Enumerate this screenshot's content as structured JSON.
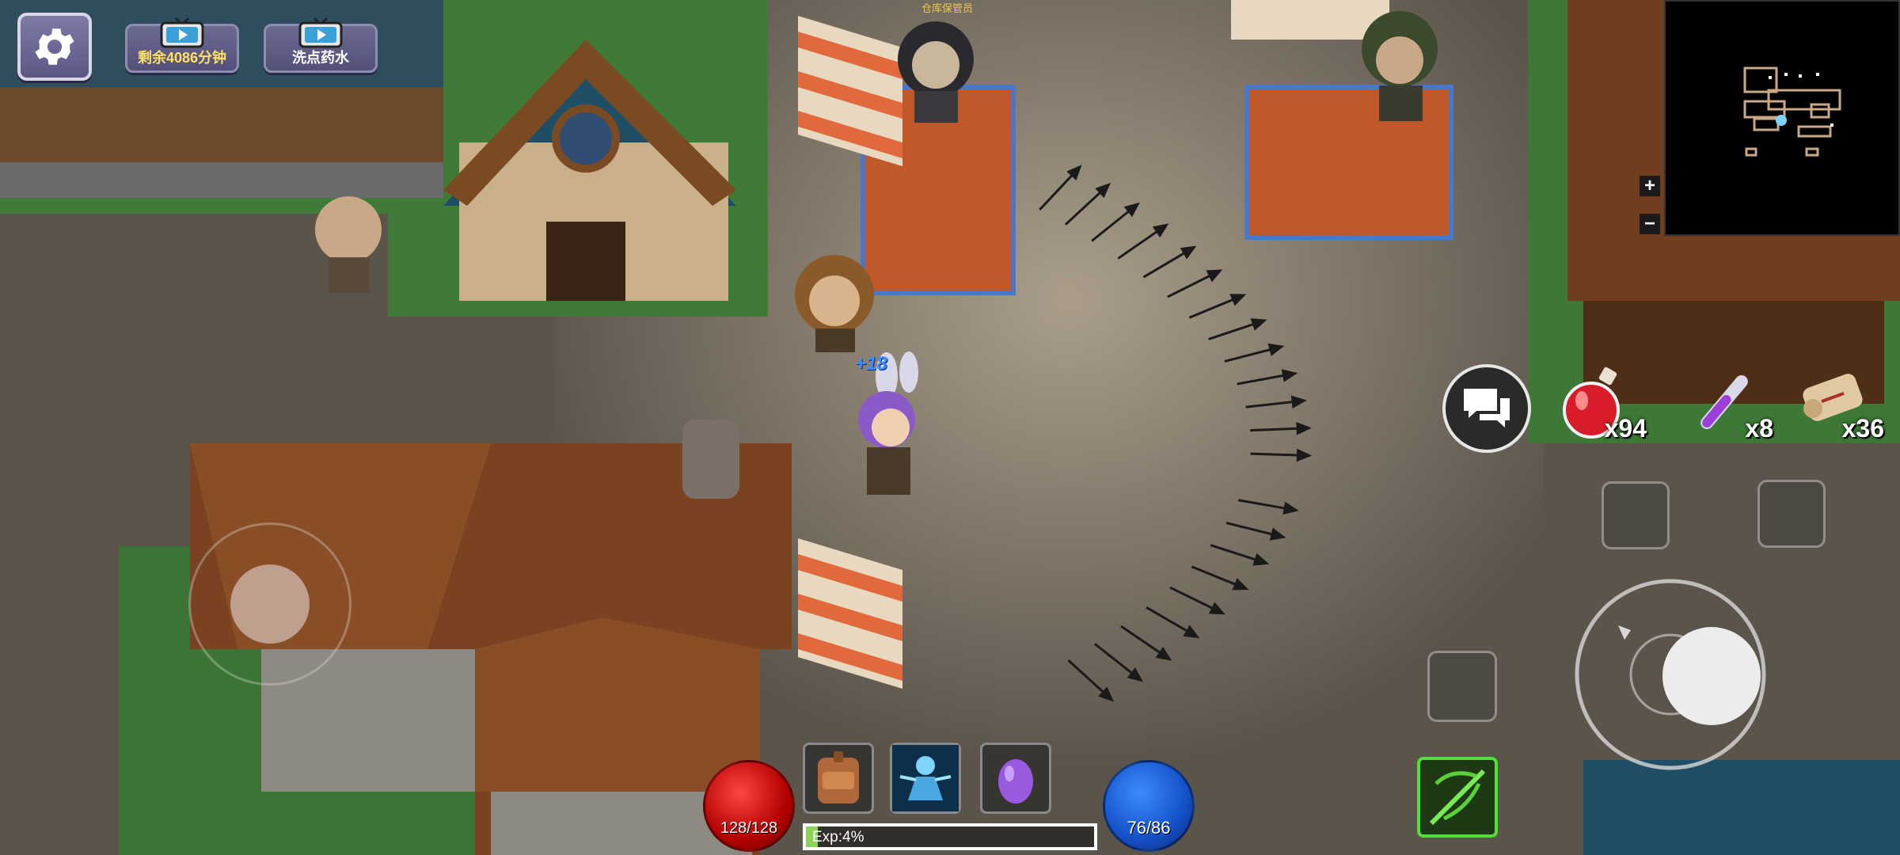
{
  "hud": {
    "settings": {
      "icon": "gear-icon"
    },
    "video_buttons": [
      {
        "icon": "tv-play-icon",
        "label": "剩余4086分钟",
        "label_color": "#ffe066"
      },
      {
        "icon": "tv-play-icon",
        "label": "洗点药水",
        "label_color": "#ffffff"
      }
    ],
    "minimap": {
      "zoom_in": "+",
      "zoom_out": "−"
    },
    "chat": {
      "icon": "chat-bubbles-icon"
    },
    "quick_items": [
      {
        "icon": "red-potion-icon",
        "count": "x94"
      },
      {
        "icon": "purple-vial-icon",
        "count": "x8"
      },
      {
        "icon": "scroll-icon",
        "count": "x36"
      }
    ],
    "hp": {
      "text": "128/128",
      "color": "#d10000"
    },
    "mp": {
      "text": "76/86",
      "color": "#1c5fd8"
    },
    "exp": {
      "text": "Exp:4%",
      "fraction": 0.04
    },
    "skills": [
      {
        "icon": "backpack-icon"
      },
      {
        "icon": "spirit-figure-icon"
      },
      {
        "icon": "purple-egg-icon"
      }
    ],
    "weapon": {
      "icon": "crossbow-icon"
    }
  },
  "world": {
    "floating_heal": "+18",
    "npc_name": "仓库保管员"
  }
}
